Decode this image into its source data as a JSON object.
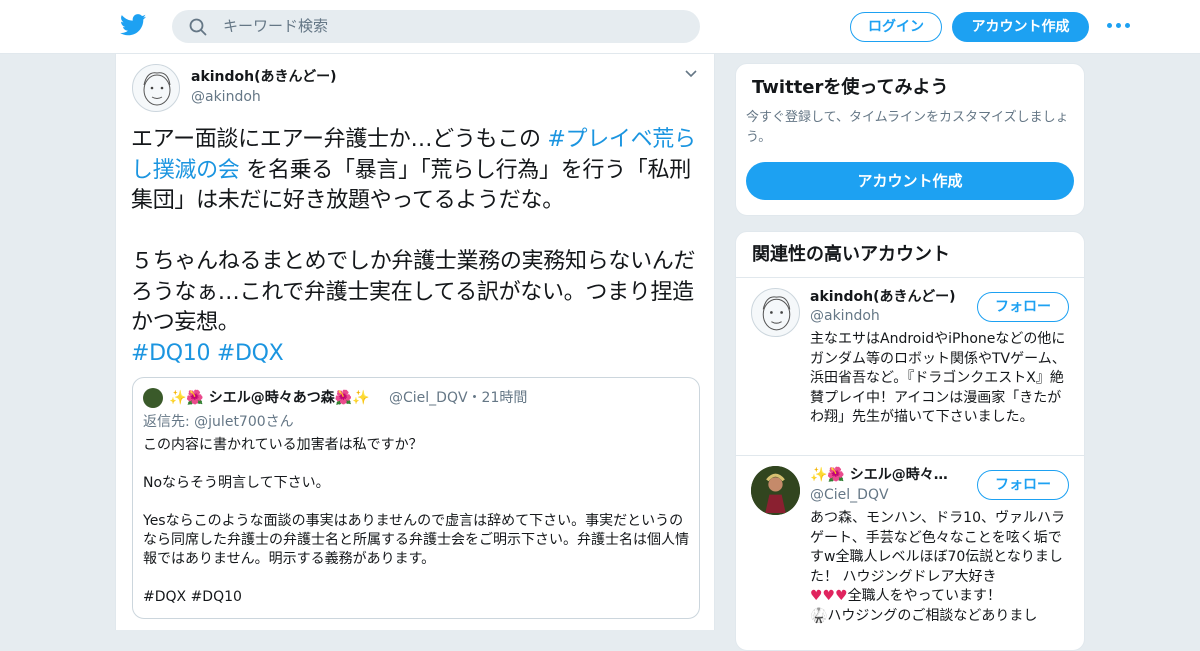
{
  "header": {
    "search_placeholder": "キーワード検索",
    "login_label": "ログイン",
    "signup_label": "アカウント作成"
  },
  "tweet": {
    "display_name": "akindoh(あきんどー)",
    "handle": "@akindoh",
    "text_part1": "エアー面談にエアー弁護士か…どうもこの ",
    "hashtag1": "#プレイベ荒らし撲滅の会",
    "text_part2": " を名乗る「暴言」「荒らし行為」を行う「私刑集団」は未だに好き放題やってるようだな。",
    "text_para2": "５ちゃんねるまとめでしか弁護士業務の実務知らないんだろうなぁ…これで弁護士実在してる訳がない。つまり捏造かつ妄想。",
    "hashtags_line": "#DQ10 #DQX"
  },
  "quote": {
    "display_name": "✨🌺 シエル@時々あつ森🌺✨",
    "handle_time": "@Ciel_DQV・21時間",
    "reply_label": "返信先: ",
    "reply_target": "@julet700さん",
    "lines": [
      "この内容に書かれている加害者は私ですか？",
      "Noならそう明言して下さい。",
      "Yesならこのような面談の事実はありませんので虚言は辞めて下さい。事実だというのなら同席した弁護士の弁護士名と所属する弁護士会をご明示下さい。弁護士名は個人情報ではありません。明示する義務があります。",
      "#DQX #DQ10"
    ]
  },
  "sidebar": {
    "try_title": "Twitterを使ってみよう",
    "try_subtitle": "今すぐ登録して、タイムラインをカスタマイズしましょう。",
    "try_button": "アカウント作成",
    "related_title": "関連性の高いアカウント",
    "accounts": [
      {
        "name": "akindoh(あきんどー)",
        "handle": "@akindoh",
        "follow": "フォロー",
        "bio": "主なエサはAndroidやiPhoneなどの他にガンダム等のロボット関係やTVゲーム、浜田省吾など。『ドラゴンクエストX』絶賛プレイ中！アイコンは漫画家「きたがわ翔」先生が描いて下さいました。"
      },
      {
        "name": "✨🌺 シエル@時々…",
        "handle": "@Ciel_DQV",
        "follow": "フォロー",
        "bio": "あつ森、モンハン、ドラ10、ヴァルハラゲート、手芸など色々なことを呟く垢ですw全職人レベルほぼ70伝説となりました！ ハウジングドレア大好き",
        "bio_line2": "全職人をやっています！",
        "bio_line3": "🥋ハウジングのご相談などありまし"
      }
    ]
  },
  "colors": {
    "accent": "#1da1f2",
    "link": "#1b95e0",
    "muted": "#657786",
    "background": "#e6ecf0"
  }
}
